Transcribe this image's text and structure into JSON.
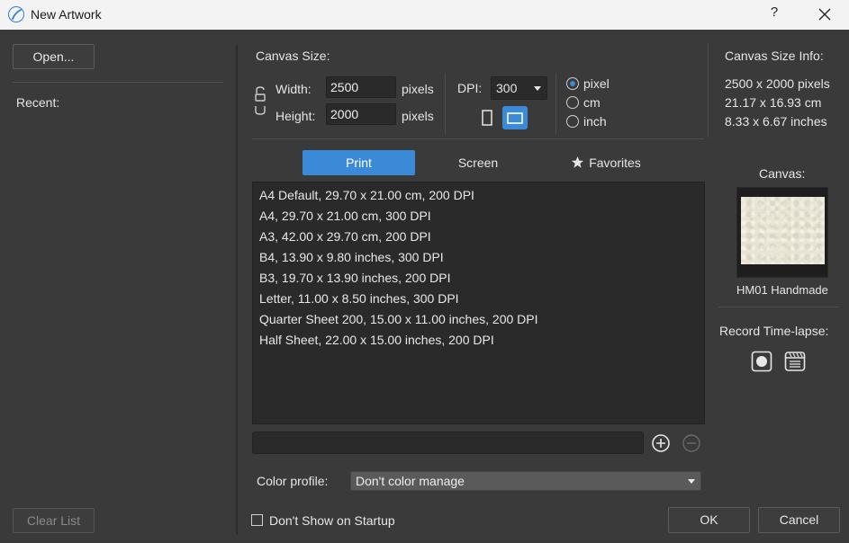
{
  "window": {
    "title": "New Artwork",
    "help_label": "?"
  },
  "left": {
    "open_label": "Open...",
    "recent_label": "Recent:",
    "clear_label": "Clear List"
  },
  "canvas_size": {
    "heading": "Canvas Size:",
    "width_label": "Width:",
    "width_value": "2500",
    "width_unit": "pixels",
    "height_label": "Height:",
    "height_value": "2000",
    "height_unit": "pixels",
    "dpi_label": "DPI:",
    "dpi_value": "300",
    "orientation": "landscape",
    "units": [
      {
        "label": "pixel",
        "selected": true
      },
      {
        "label": "cm",
        "selected": false
      },
      {
        "label": "inch",
        "selected": false
      }
    ]
  },
  "info": {
    "heading": "Canvas Size Info:",
    "pixels": "2500 x 2000 pixels",
    "cm": "21.17 x 16.93 cm",
    "inches": "8.33 x 6.67 inches"
  },
  "tabs": [
    {
      "label": "Print",
      "active": true
    },
    {
      "label": "Screen",
      "active": false
    },
    {
      "label": "Favorites",
      "active": false
    }
  ],
  "presets": [
    "A4 Default, 29.70 x 21.00 cm, 200 DPI",
    "A4, 29.70 x 21.00 cm, 300 DPI",
    "A3, 42.00 x 29.70 cm, 200 DPI",
    "B4, 13.90 x 9.80 inches, 300 DPI",
    "B3, 19.70 x 13.90 inches, 200 DPI",
    "Letter, 11.00 x 8.50 inches, 300 DPI",
    "Quarter Sheet 200, 15.00 x 11.00 inches, 200 DPI",
    "Half Sheet, 22.00 x 15.00 inches, 200 DPI"
  ],
  "preset_name_value": "",
  "color_profile": {
    "label": "Color profile:",
    "value": "Don't color manage"
  },
  "startup": {
    "label": "Don't Show on Startup",
    "checked": false
  },
  "canvas_panel": {
    "heading": "Canvas:",
    "paper_name": "HM01 Handmade"
  },
  "timelapse": {
    "heading": "Record Time-lapse:"
  },
  "buttons": {
    "ok": "OK",
    "cancel": "Cancel"
  },
  "colors": {
    "accent": "#3b8ad7",
    "background": "#3a3a3a",
    "field": "#2a2a2a"
  }
}
